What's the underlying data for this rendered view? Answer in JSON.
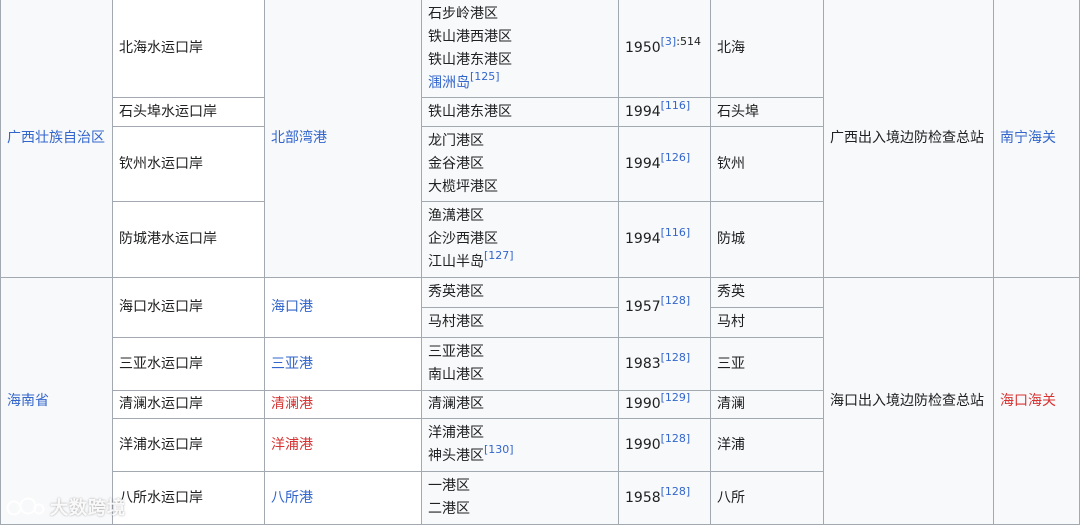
{
  "rows": [
    {
      "province": "广西壮族自治区",
      "port": "北海水运口岸",
      "harbor": "北部湾港",
      "areas": [
        "石步岭港区",
        "铁山港西港区",
        "铁山港东港区",
        "涠洲岛"
      ],
      "areas_last_ref": "[125]",
      "year": "1950",
      "year_ref": "[3]",
      "year_ref_tail": ":514",
      "place": "北海",
      "inspection": "广西出入境边防检查总站",
      "customs": "南宁海关"
    },
    {
      "port": "石头埠水运口岸",
      "areas": [
        "铁山港东港区"
      ],
      "year": "1994",
      "year_ref": "[116]",
      "place": "石头埠"
    },
    {
      "port": "钦州水运口岸",
      "areas": [
        "龙门港区",
        "金谷港区",
        "大榄坪港区"
      ],
      "year": "1994",
      "year_ref": "[126]",
      "place": "钦州"
    },
    {
      "port": "防城港水运口岸",
      "areas": [
        "渔澫港区",
        "企沙西港区",
        "江山半岛"
      ],
      "areas_last_ref": "[127]",
      "year": "1994",
      "year_ref": "[116]",
      "place": "防城"
    },
    {
      "province": "海南省",
      "port": "海口水运口岸",
      "harbor": "海口港",
      "areas": [
        "秀英港区"
      ],
      "year": "1957",
      "year_ref": "[128]",
      "place": "秀英",
      "inspection": "海口出入境边防检查总站",
      "customs": "海口海关"
    },
    {
      "areas": [
        "马村港区"
      ],
      "place": "马村"
    },
    {
      "port": "三亚水运口岸",
      "harbor": "三亚港",
      "areas": [
        "三亚港区",
        "南山港区"
      ],
      "year": "1983",
      "year_ref": "[128]",
      "place": "三亚"
    },
    {
      "port": "清澜水运口岸",
      "harbor": "清澜港",
      "areas": [
        "清澜港区"
      ],
      "year": "1990",
      "year_ref": "[129]",
      "place": "清澜"
    },
    {
      "port": "洋浦水运口岸",
      "harbor": "洋浦港",
      "areas": [
        "洋浦港区",
        "神头港区"
      ],
      "areas_last_ref": "[130]",
      "year": "1990",
      "year_ref": "[128]",
      "place": "洋浦"
    },
    {
      "port": "八所水运口岸",
      "harbor": "八所港",
      "areas": [
        "一港区",
        "二港区"
      ],
      "year": "1958",
      "year_ref": "[128]",
      "place": "八所"
    }
  ],
  "watermark": {
    "text": "大数跨境"
  },
  "colors": {
    "link": "#3366cc",
    "redlink": "#d73333",
    "border": "#a2a9b1",
    "cell_bg": "#f8f9fa"
  }
}
